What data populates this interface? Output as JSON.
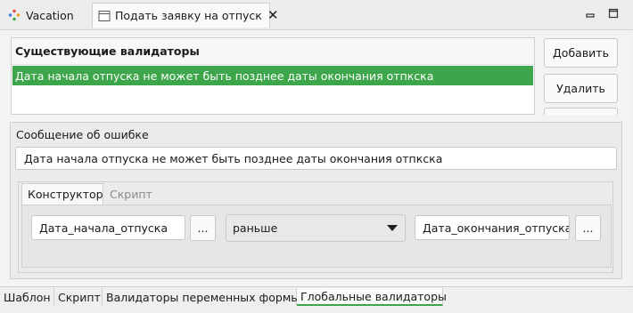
{
  "tabs": {
    "vacation_label": "Vacation",
    "active_label": "Подать заявку на отпуск"
  },
  "validators": {
    "header": "Существующие валидаторы",
    "items": [
      "Дата начала отпуска не может быть позднее даты окончания отпкска"
    ],
    "selected_color": "#3ea64a"
  },
  "buttons": {
    "add": "Добавить",
    "delete": "Удалить"
  },
  "error": {
    "label": "Сообщение об ошибке",
    "value": "Дата начала отпуска не может быть позднее даты окончания отпкска"
  },
  "constructor_tabs": {
    "constructor": "Конструктор",
    "script": "Скрипт"
  },
  "condition": {
    "left_value": "Дата_начала_отпуска",
    "operator": "раньше",
    "right_value": "Дата_окончания_отпуска",
    "browse_label": "..."
  },
  "bottom_tabs": [
    "Шаблон",
    "Скрипт",
    "Валидаторы переменных формы",
    "Глобальные валидаторы"
  ],
  "bottom_active": "Глобальные валидаторы"
}
